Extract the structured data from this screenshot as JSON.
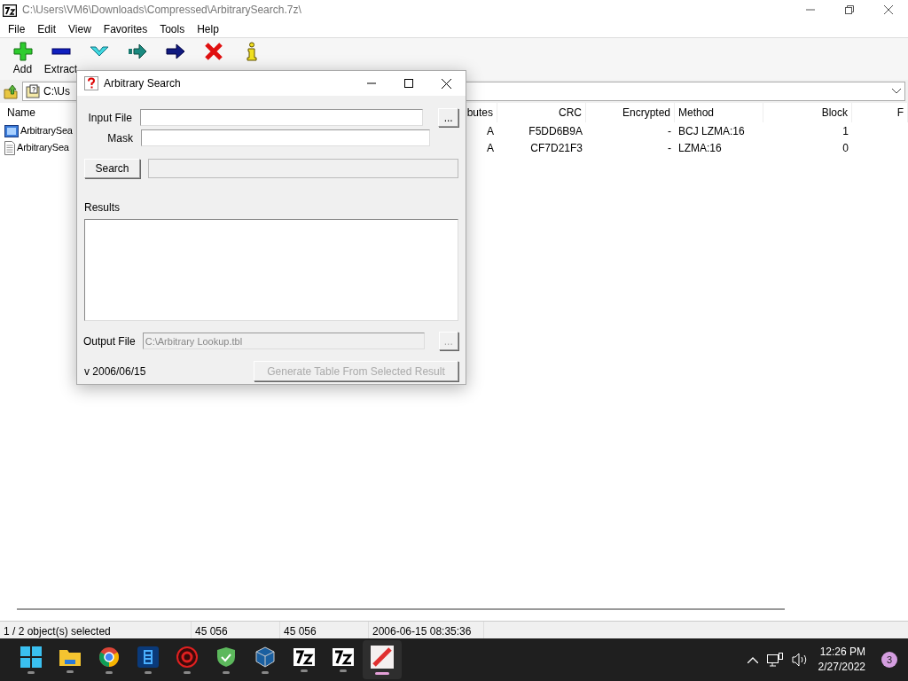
{
  "window": {
    "title": "C:\\Users\\VM6\\Downloads\\Compressed\\ArbitrarySearch.7z\\"
  },
  "menu": [
    "File",
    "Edit",
    "View",
    "Favorites",
    "Tools",
    "Help"
  ],
  "toolbar": [
    {
      "kind": "add",
      "label": "Add"
    },
    {
      "kind": "extract",
      "label": "Extract"
    },
    {
      "kind": "test"
    },
    {
      "kind": "copy"
    },
    {
      "kind": "move"
    },
    {
      "kind": "delete"
    },
    {
      "kind": "info"
    }
  ],
  "address": {
    "path": "C:\\Us"
  },
  "table": {
    "columns": [
      "Name",
      "butes",
      "CRC",
      "Encrypted",
      "Method",
      "Block",
      "F"
    ],
    "rows": [
      {
        "kind": "exe",
        "cells": [
          "ArbitrarySea",
          "A",
          "F5DD6B9A",
          "-",
          "BCJ LZMA:16",
          "1"
        ]
      },
      {
        "kind": "text",
        "cells": [
          "ArbitrarySea",
          "A",
          "CF7D21F3",
          "-",
          "LZMA:16",
          "0"
        ]
      }
    ]
  },
  "dialog": {
    "title": "Arbitrary Search",
    "input_label": "Input File",
    "input_browse": "...",
    "mask_label": "Mask",
    "search_button": "Search",
    "results_label": "Results",
    "output_label": "Output File",
    "output_value": "C:\\Arbitrary Lookup.tbl",
    "output_browse": {
      "label": "...",
      "disabled": true
    },
    "version": "v 2006/06/15",
    "generate_button": {
      "label": "Generate Table From Selected Result",
      "disabled": true
    }
  },
  "status_bar": [
    "1 / 2 object(s) selected",
    "45 056",
    "45 056",
    "2006-06-15 08:35:36"
  ],
  "taskbar": {
    "apps": [
      {
        "kind": "start",
        "active": false
      },
      {
        "kind": "folder",
        "active": false
      },
      {
        "kind": "browser",
        "active": false
      },
      {
        "kind": "blue",
        "active": false
      },
      {
        "kind": "red",
        "active": false
      },
      {
        "kind": "shield",
        "active": false
      },
      {
        "kind": "cube",
        "active": false
      },
      {
        "kind": "sevenzip",
        "active": false
      },
      {
        "kind": "sevenzip",
        "active": false
      },
      {
        "kind": "search",
        "active": true
      }
    ],
    "time": "12:26 PM",
    "date": "2/27/2022",
    "badge": "3"
  }
}
